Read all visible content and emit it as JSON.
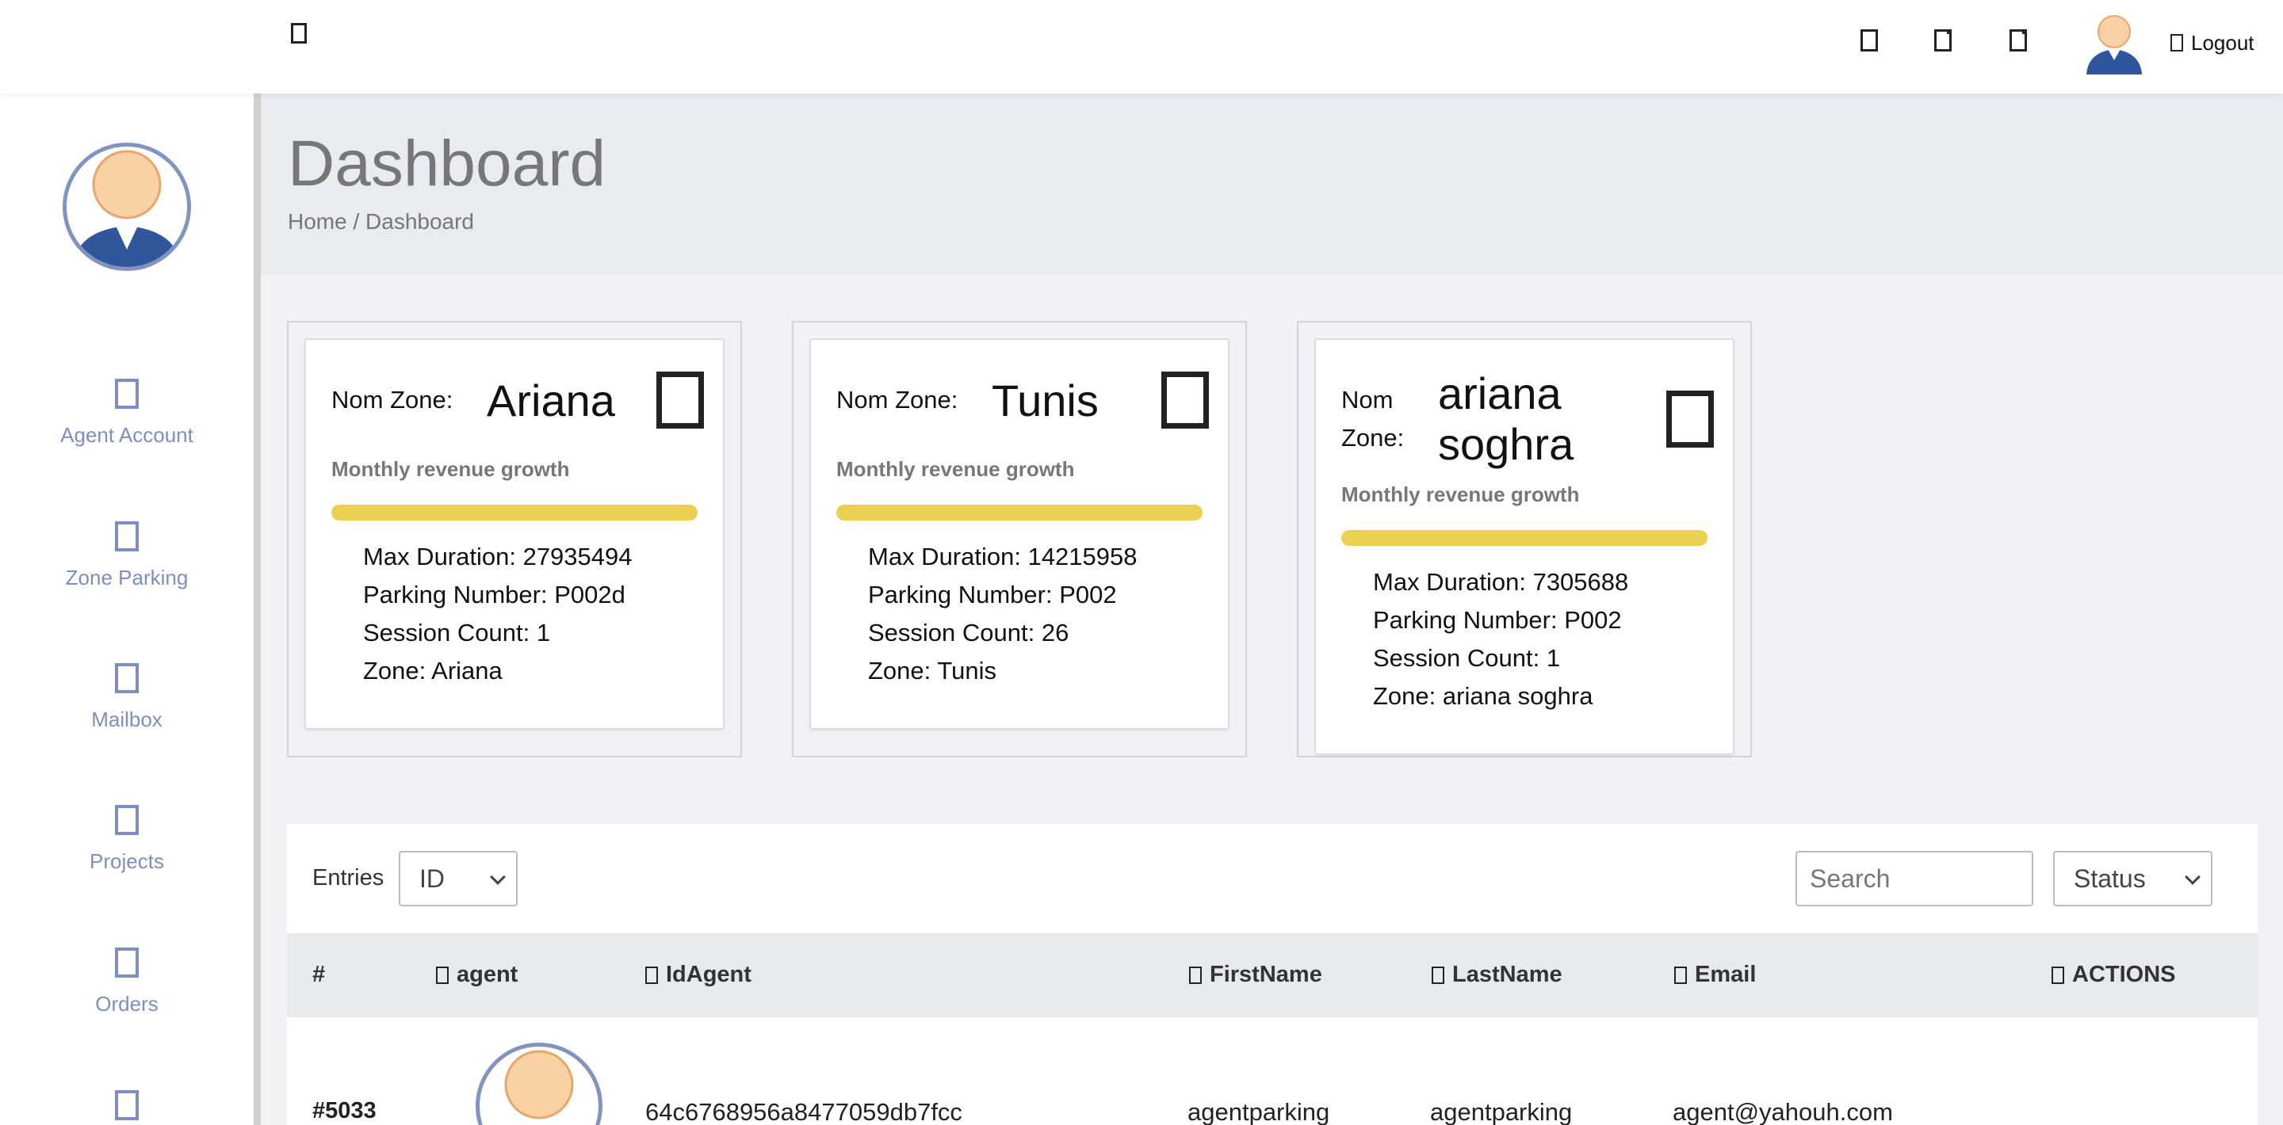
{
  "header": {
    "logout_label": "Logout"
  },
  "sidebar": {
    "items": [
      {
        "label": "Agent Account",
        "icon": "agent-account-icon"
      },
      {
        "label": "Zone Parking",
        "icon": "zone-parking-icon"
      },
      {
        "label": "Mailbox",
        "icon": "mailbox-icon"
      },
      {
        "label": "Projects",
        "icon": "projects-icon"
      },
      {
        "label": "Orders",
        "icon": "orders-icon"
      }
    ]
  },
  "page": {
    "title": "Dashboard",
    "breadcrumb": "Home / Dashboard"
  },
  "cards": [
    {
      "zone_label": "Nom Zone:",
      "zone_name": "Ariana",
      "growth_text": "Monthly revenue growth",
      "max_duration": "Max Duration: 27935494",
      "parking_number": "Parking Number: P002d",
      "session_count": "Session Count: 1",
      "zone": "Zone: Ariana"
    },
    {
      "zone_label": "Nom Zone:",
      "zone_name": "Tunis",
      "growth_text": "Monthly revenue growth",
      "max_duration": "Max Duration: 14215958",
      "parking_number": "Parking Number: P002",
      "session_count": "Session Count: 26",
      "zone": "Zone: Tunis"
    },
    {
      "zone_label_line1": "Nom",
      "zone_label_line2": "Zone:",
      "zone_name_line1": "ariana",
      "zone_name_line2": "soghra",
      "growth_text": "Monthly revenue growth",
      "max_duration": "Max Duration: 7305688",
      "parking_number": "Parking Number: P002",
      "session_count": "Session Count: 1",
      "zone": "Zone: ariana soghra"
    }
  ],
  "table": {
    "entries_label": "Entries",
    "entries_select_value": "ID",
    "search_placeholder": "Search",
    "status_select_value": "Status",
    "columns": [
      "#",
      "agent",
      "IdAgent",
      "FirstName",
      "LastName",
      "Email",
      "ACTIONS"
    ],
    "rows": [
      {
        "id": "#5033",
        "id_agent": "64c6768956a8477059db7fcc",
        "first_name": "agentparking",
        "last_name": "agentparking",
        "email": "agent@yahouh.com"
      }
    ]
  }
}
